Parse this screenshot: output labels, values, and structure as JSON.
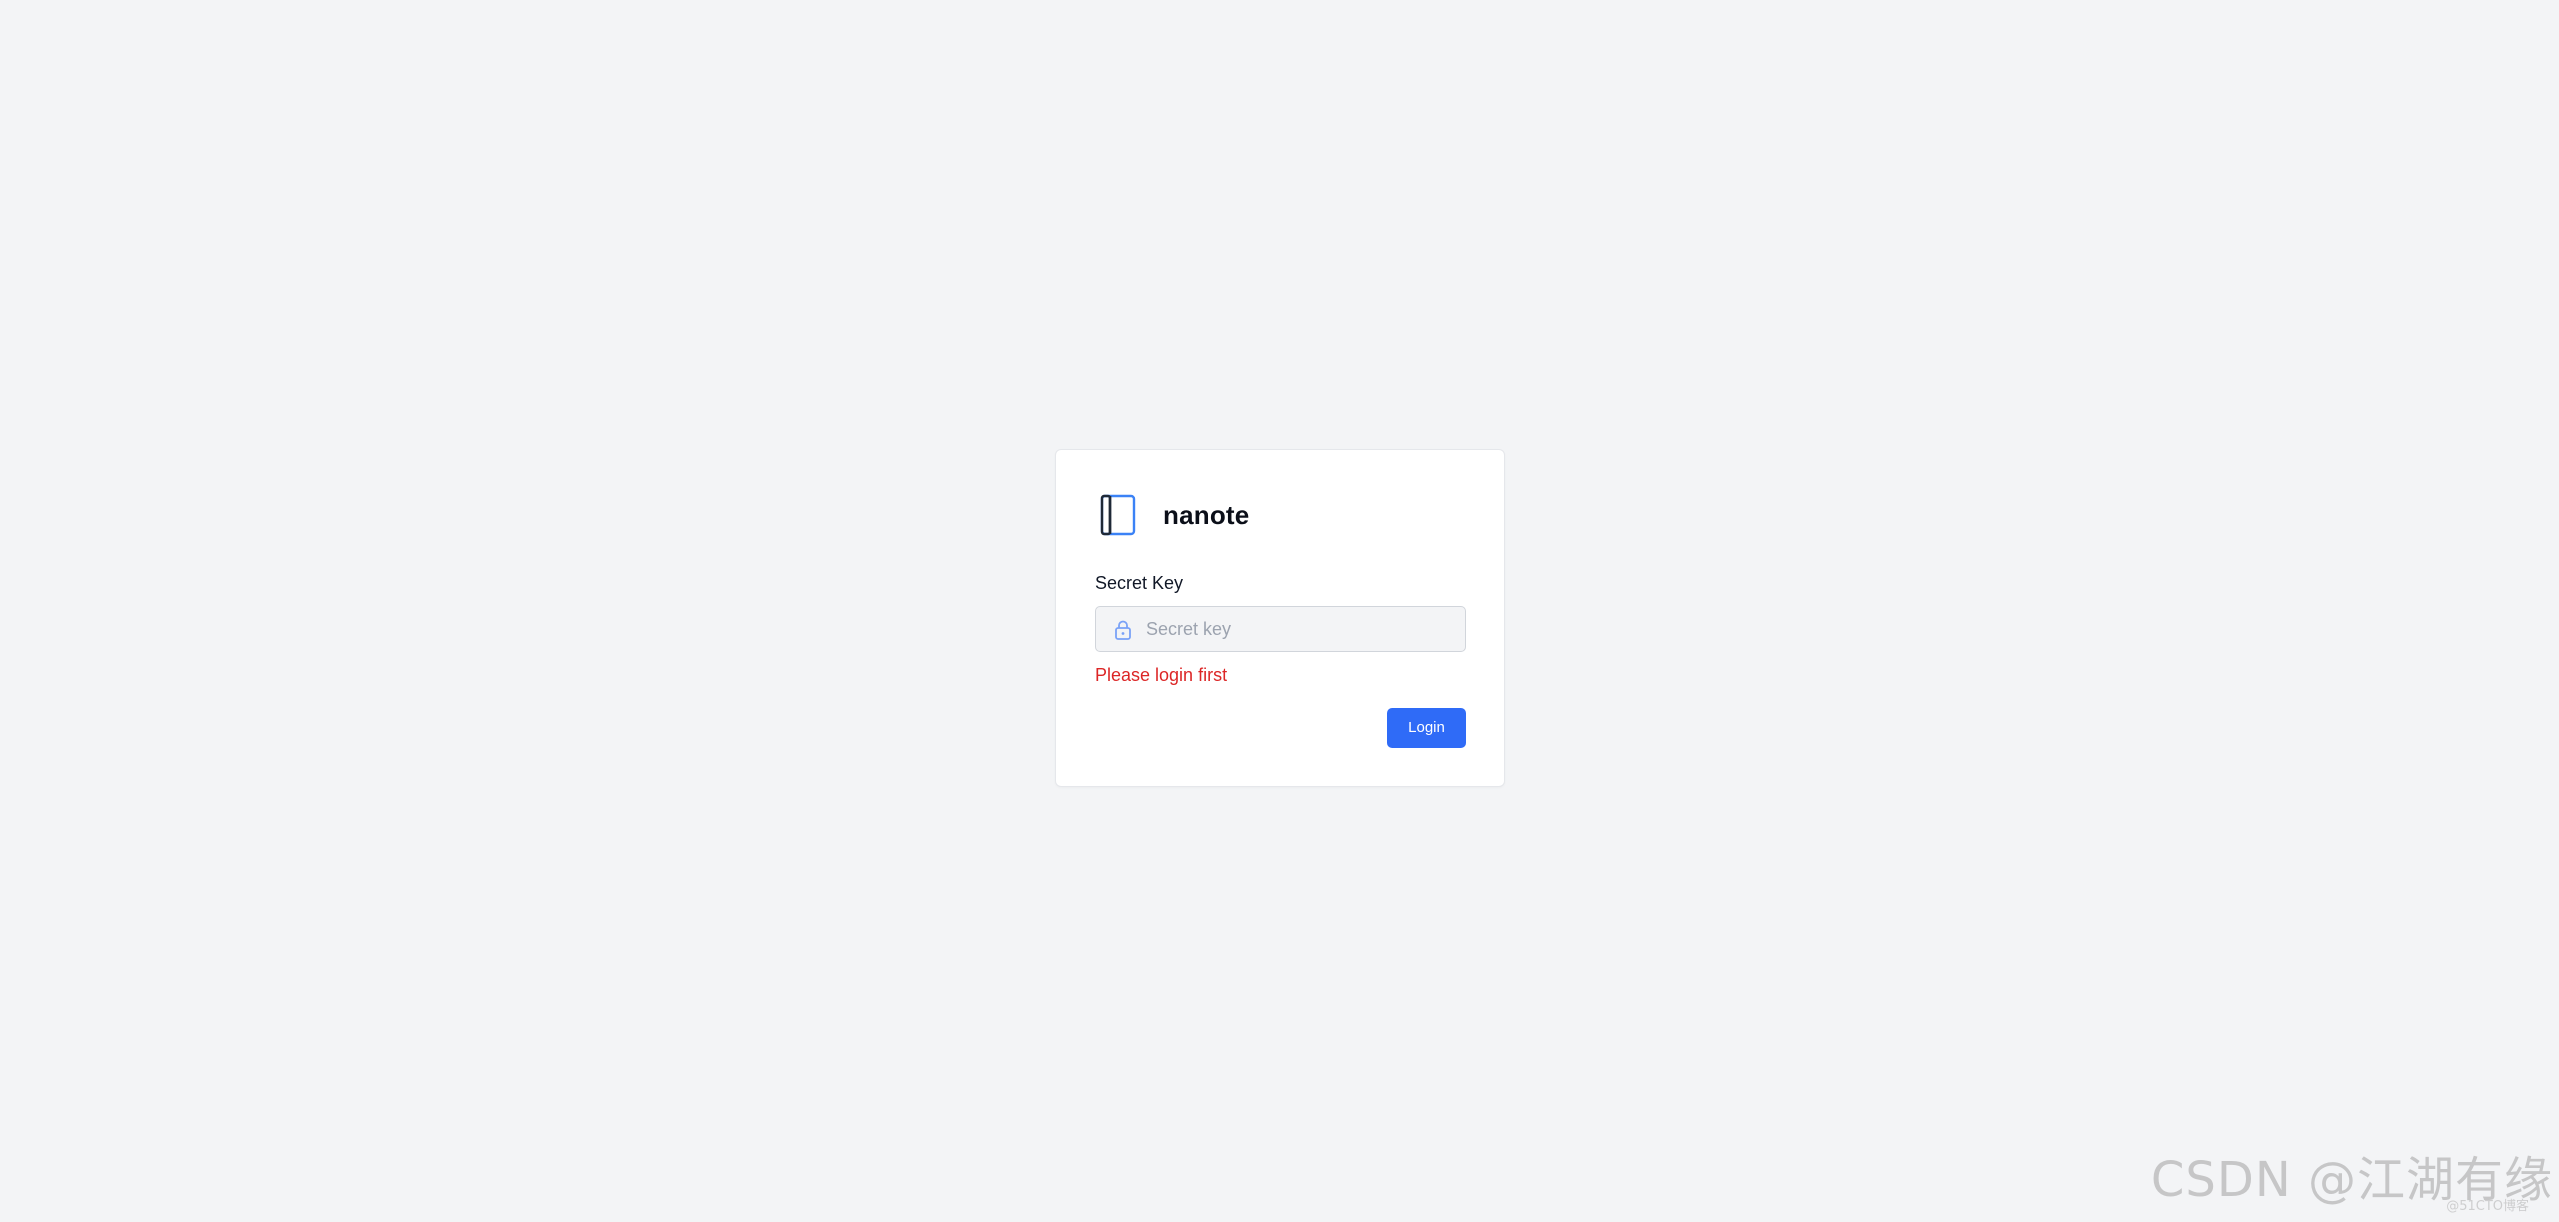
{
  "app": {
    "name": "nanote",
    "logo_icon": "notebook-icon"
  },
  "login_form": {
    "field_label": "Secret Key",
    "input_value": "",
    "input_placeholder": "Secret key",
    "input_icon": "lock-icon",
    "error_message": "Please login first",
    "submit_label": "Login"
  },
  "colors": {
    "page_background": "#f3f4f6",
    "card_background": "#ffffff",
    "primary": "#2f6bf7",
    "error": "#dc2626",
    "logo_accent": "#3b82f6",
    "logo_dark": "#1f2937"
  },
  "watermark": {
    "text": "CSDN @江湖有缘",
    "subtext": "@51CTO博客"
  }
}
